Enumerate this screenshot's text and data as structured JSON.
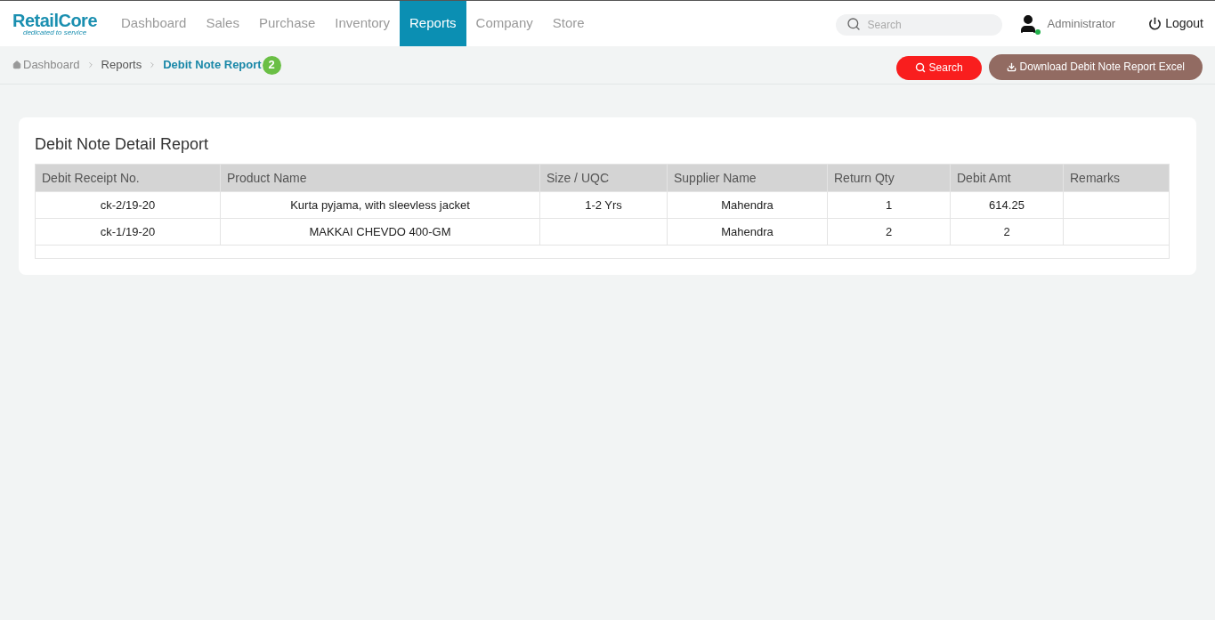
{
  "brand": {
    "name": "RetailCore",
    "tagline": "dedicated to service"
  },
  "nav": [
    {
      "label": "Dashboard",
      "selected": false
    },
    {
      "label": "Sales",
      "selected": false
    },
    {
      "label": "Purchase",
      "selected": false
    },
    {
      "label": "Inventory",
      "selected": false
    },
    {
      "label": "Reports",
      "selected": true
    },
    {
      "label": "Company",
      "selected": false
    },
    {
      "label": "Store",
      "selected": false
    }
  ],
  "search": {
    "placeholder": "Search"
  },
  "user": {
    "name": "Administrator",
    "online": true
  },
  "logout": "Logout",
  "breadcrumb": [
    "Dashboard",
    "Reports",
    "Debit Note Report"
  ],
  "badge": "2",
  "actions": {
    "search": "Search",
    "download": "Download Debit Note Report Excel"
  },
  "report": {
    "title": "Debit Note Detail Report",
    "columns": [
      "Debit Receipt No.",
      "Product Name",
      "Size / UQC",
      "Supplier Name",
      "Return Qty",
      "Debit Amt",
      "Remarks"
    ],
    "rows": [
      [
        "ck-2/19-20",
        "Kurta pyjama, with sleevless jacket",
        "1-2 Yrs",
        "Mahendra",
        "1",
        "614.25",
        null
      ],
      [
        "ck-1/19-20",
        "MAKKAI CHEVDO 400-GM",
        null,
        "Mahendra",
        "2",
        "2",
        null
      ]
    ]
  }
}
